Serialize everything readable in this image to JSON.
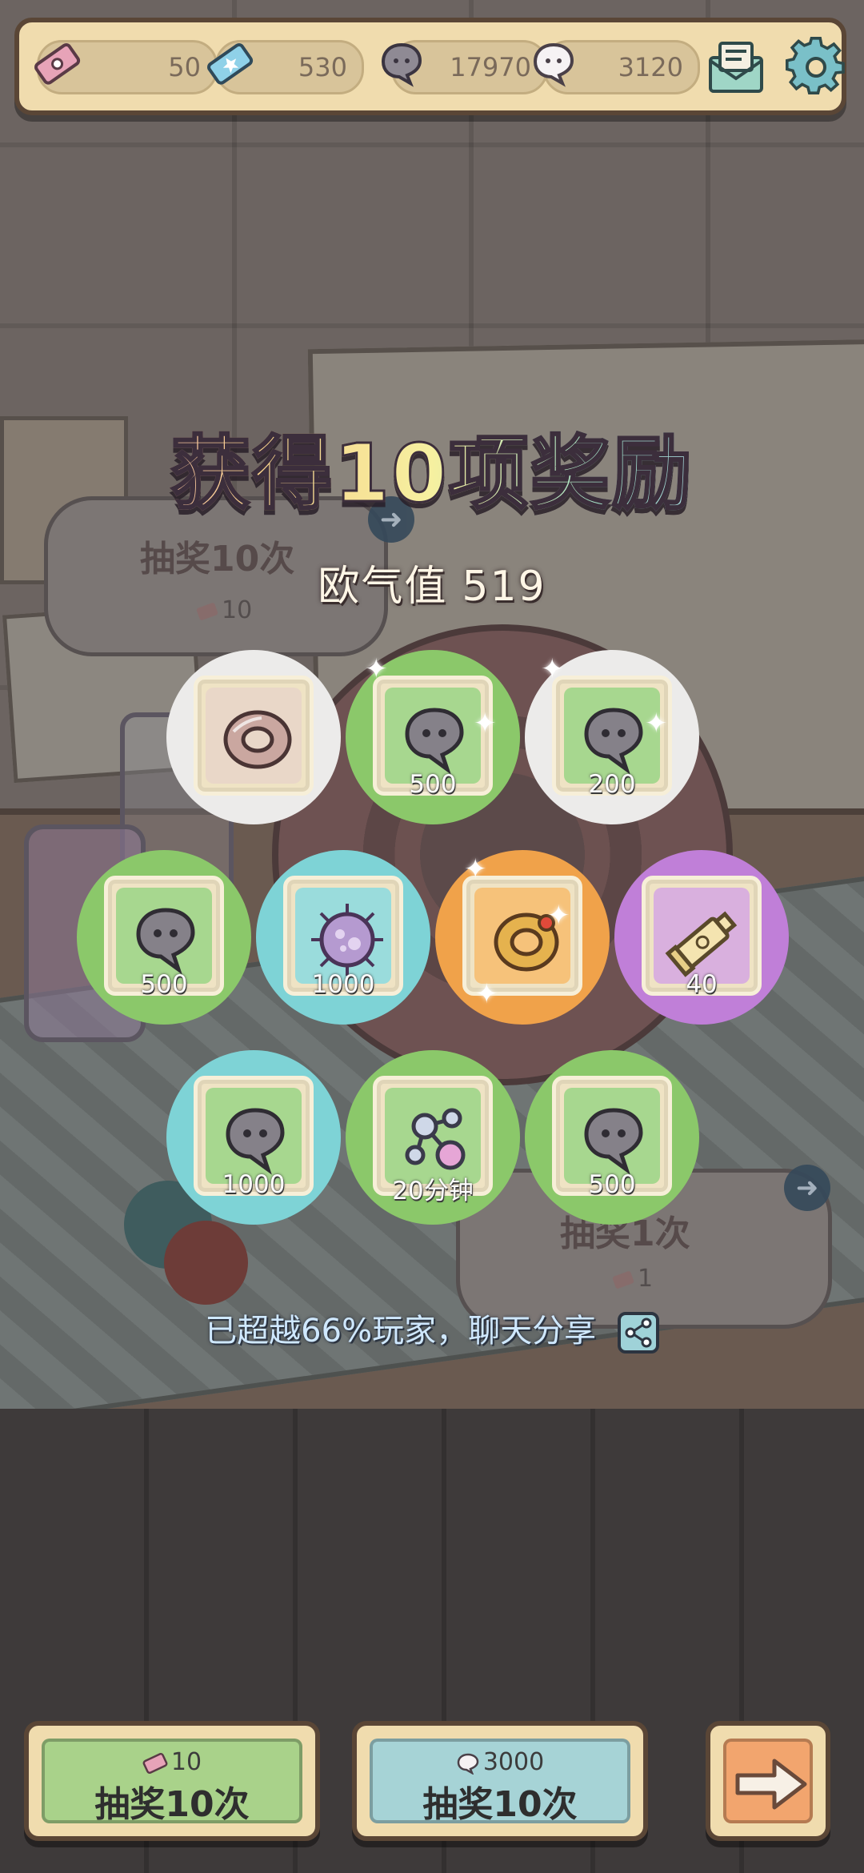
{
  "resources": [
    {
      "name": "ticket",
      "value": "50"
    },
    {
      "name": "blue-ticket",
      "value": "530"
    },
    {
      "name": "dark-ghost-coin",
      "value": "17970"
    },
    {
      "name": "white-ghost-coin",
      "value": "3120"
    }
  ],
  "background": {
    "draw10_label": "抽奖10次",
    "draw10_cost": "10",
    "draw1_label": "抽奖1次",
    "draw1_cost": "1"
  },
  "result": {
    "title": "获得10项奖励",
    "luck_label": "欧气值",
    "luck_value": "519",
    "rank_text": "已超越66%玩家，聊天分享"
  },
  "rewards": [
    {
      "item": "ring-icon",
      "qty": "",
      "bg": "#ecebea"
    },
    {
      "item": "ghost-coin-icon",
      "qty": "500",
      "bg": "#8bc86a"
    },
    {
      "item": "ghost-coin-icon",
      "qty": "200",
      "bg": "#ecebea"
    },
    {
      "item": "ghost-coin-icon",
      "qty": "500",
      "bg": "#8bc86a"
    },
    {
      "item": "virus-icon",
      "qty": "1000",
      "bg": "#7ed3d6"
    },
    {
      "item": "golden-ring-icon",
      "qty": "",
      "bg": "#f0a24a"
    },
    {
      "item": "tube-icon",
      "qty": "40",
      "bg": "#c07fd8"
    },
    {
      "item": "ghost-coin-icon",
      "qty": "1000",
      "bg": "#7ed3d6"
    },
    {
      "item": "molecule-icon",
      "qty": "20分钟",
      "bg": "#8bc86a"
    },
    {
      "item": "ghost-coin-icon",
      "qty": "500",
      "bg": "#8bc86a"
    }
  ],
  "buttons": {
    "draw10_ticket": {
      "cost": "10",
      "label": "抽奖10次",
      "color": "#a9d28a"
    },
    "draw10_coin": {
      "cost": "3000",
      "label": "抽奖10次",
      "color": "#a6d3d6"
    },
    "next": {
      "icon": "arrow-right-icon",
      "color": "#f2a56e"
    }
  }
}
